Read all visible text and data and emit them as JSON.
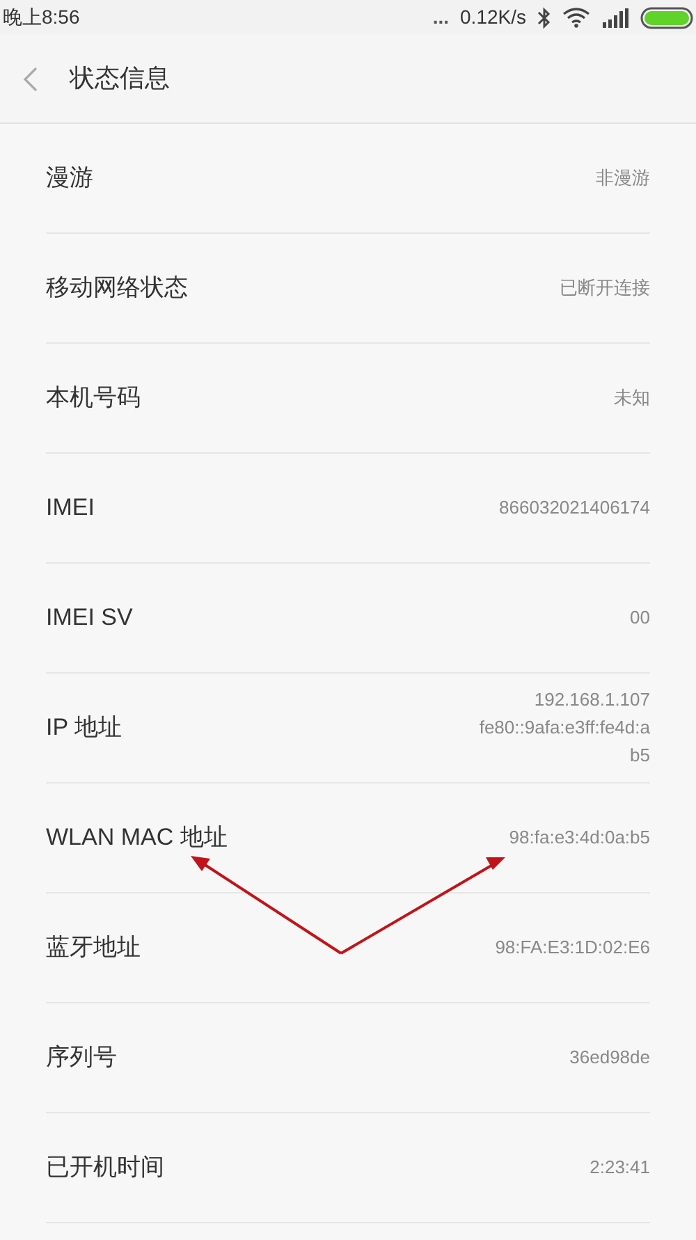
{
  "status_bar": {
    "time": "晚上8:56",
    "dots": "...",
    "speed": "0.12K/s"
  },
  "header": {
    "title": "状态信息"
  },
  "rows": [
    {
      "label": "漫游",
      "value": [
        "非漫游"
      ]
    },
    {
      "label": "移动网络状态",
      "value": [
        "已断开连接"
      ]
    },
    {
      "label": "本机号码",
      "value": [
        "未知"
      ]
    },
    {
      "label": "IMEI",
      "value": [
        "866032021406174"
      ]
    },
    {
      "label": "IMEI SV",
      "value": [
        "00"
      ]
    },
    {
      "label": "IP 地址",
      "value": [
        "192.168.1.107",
        "fe80::9afa:e3ff:fe4d:a",
        "b5"
      ]
    },
    {
      "label": "WLAN MAC 地址",
      "value": [
        "98:fa:e3:4d:0a:b5"
      ]
    },
    {
      "label": "蓝牙地址",
      "value": [
        "98:FA:E3:1D:02:E6"
      ]
    },
    {
      "label": "序列号",
      "value": [
        "36ed98de"
      ]
    },
    {
      "label": "已开机时间",
      "value": [
        "2:23:41"
      ]
    }
  ]
}
